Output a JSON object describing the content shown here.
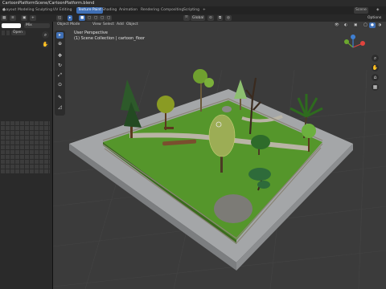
{
  "window": {
    "title": "CartoonPlatformScene/CartoonPlatform.blend"
  },
  "workspaces": [
    {
      "label": "Layout",
      "active": false
    },
    {
      "label": "Modeling",
      "active": false
    },
    {
      "label": "Sculpting",
      "active": false
    },
    {
      "label": "UV Editing",
      "active": false
    },
    {
      "label": "Texture Paint",
      "active": true
    },
    {
      "label": "Shading",
      "active": false
    },
    {
      "label": "Animation",
      "active": false
    },
    {
      "label": "Rendering",
      "active": false
    },
    {
      "label": "Compositing",
      "active": false
    },
    {
      "label": "Scripting",
      "active": false
    }
  ],
  "topright": {
    "scene": "Scene",
    "options": "Options"
  },
  "left_panel": {
    "image_field": "",
    "mix_label": "Mix",
    "open_button": "Open"
  },
  "viewport_header": {
    "mode": "Object Mode",
    "menus": [
      "View",
      "Select",
      "Add",
      "Object"
    ],
    "orientation": "Global"
  },
  "viewport": {
    "perspective": "User Perspective",
    "collection": "(1) Scene Collection | cartoon_floor"
  },
  "icons": {
    "tools": [
      "select-box-icon",
      "cursor-icon",
      "move-icon",
      "rotate-icon",
      "scale-icon",
      "transform-icon",
      "annotate-icon",
      "measure-icon"
    ],
    "nav": [
      "zoom-icon",
      "pan-icon",
      "camera-icon",
      "perspective-icon"
    ]
  },
  "colors": {
    "accent": "#3f6fb5",
    "grass": "#55962b",
    "path": "#b9b4a5",
    "stone_border": "#9c9ea0",
    "viewport_bg": "#3b3b3b"
  }
}
